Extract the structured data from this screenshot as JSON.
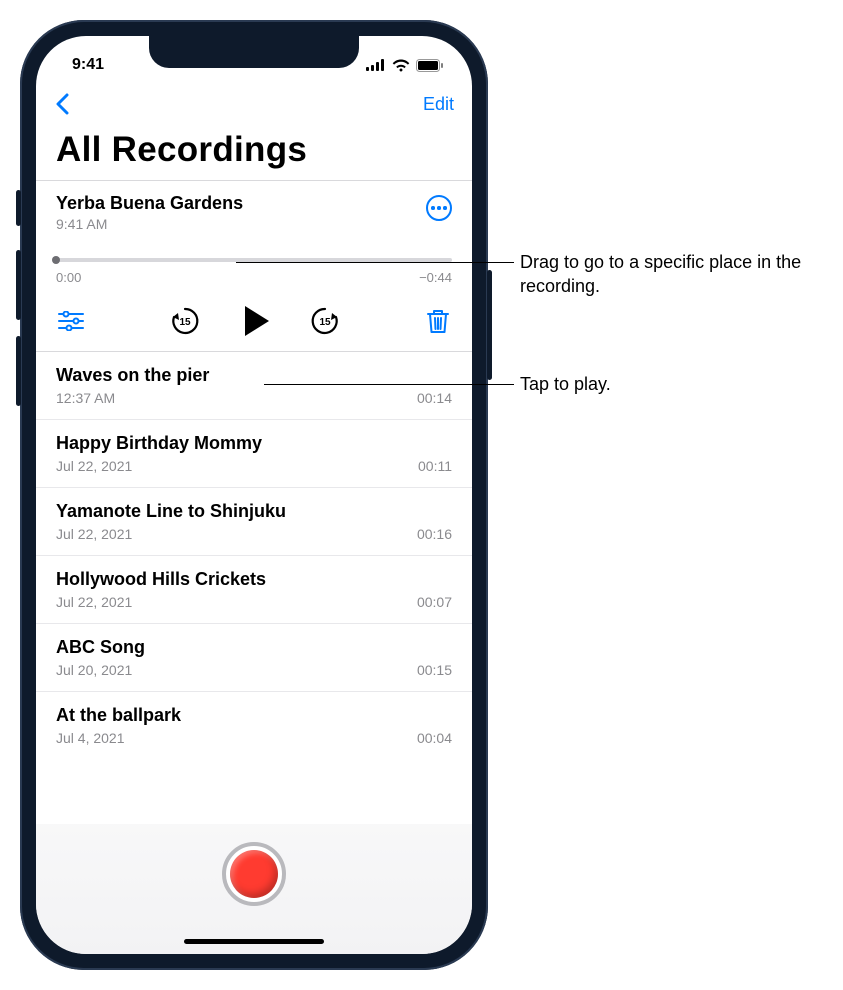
{
  "status": {
    "time": "9:41"
  },
  "nav": {
    "edit": "Edit"
  },
  "title": "All Recordings",
  "expanded": {
    "title": "Yerba Buena Gardens",
    "subtitle": "9:41 AM",
    "elapsed": "0:00",
    "remaining": "−0:44"
  },
  "recordings": [
    {
      "title": "Waves on the pier",
      "subtitle": "12:37 AM",
      "duration": "00:14"
    },
    {
      "title": "Happy Birthday Mommy",
      "subtitle": "Jul 22, 2021",
      "duration": "00:11"
    },
    {
      "title": "Yamanote Line to Shinjuku",
      "subtitle": "Jul 22, 2021",
      "duration": "00:16"
    },
    {
      "title": "Hollywood Hills Crickets",
      "subtitle": "Jul 22, 2021",
      "duration": "00:07"
    },
    {
      "title": "ABC Song",
      "subtitle": "Jul 20, 2021",
      "duration": "00:15"
    },
    {
      "title": "At the ballpark",
      "subtitle": "Jul 4, 2021",
      "duration": "00:04"
    }
  ],
  "callouts": {
    "scrub": "Drag to go to a specific place in the recording.",
    "play": "Tap to play."
  }
}
